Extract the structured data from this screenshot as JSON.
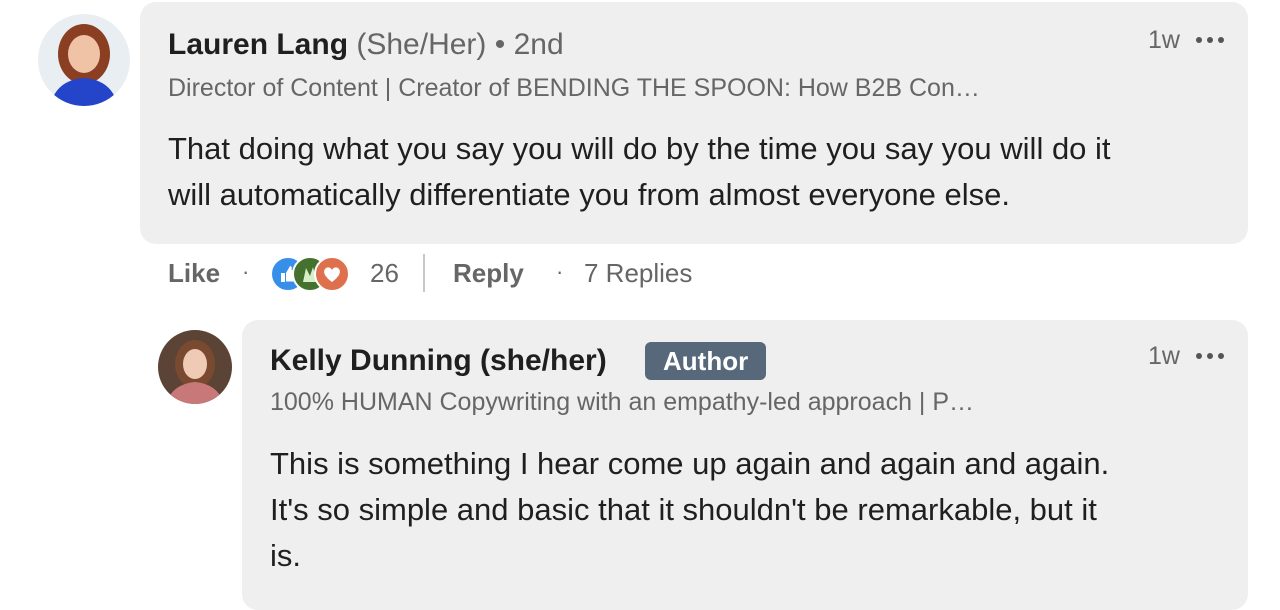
{
  "comment": {
    "author_name": "Lauren Lang",
    "pronouns": "(She/Her)",
    "degree": "• 2nd",
    "headline": "Director of Content | Creator of BENDING THE SPOON: How B2B Con…",
    "time": "1w",
    "text_line1": "That doing what you say you will do by the time you say you will do it",
    "text_line2": "will automatically differentiate you from almost everyone else.",
    "actions": {
      "like_label": "Like",
      "reaction_count": "26",
      "reply_label": "Reply",
      "replies_label": "7 Replies"
    },
    "reactions": [
      "like-icon",
      "celebrate-icon",
      "love-icon"
    ]
  },
  "reply": {
    "author_name": "Kelly Dunning (she/her)",
    "badge": "Author",
    "headline": "100% HUMAN Copywriting with an empathy-led approach | P…",
    "time": "1w",
    "text_line1": "This is something I hear come up again and again and again.",
    "text_line2": "It's so simple and basic that it shouldn't be remarkable, but it",
    "text_line3": "is."
  },
  "colors": {
    "bubble": "#efefef",
    "badge": "#56687a",
    "like_blue": "#378fe9",
    "celebrate_green": "#44712e",
    "love_orange": "#df704d"
  }
}
